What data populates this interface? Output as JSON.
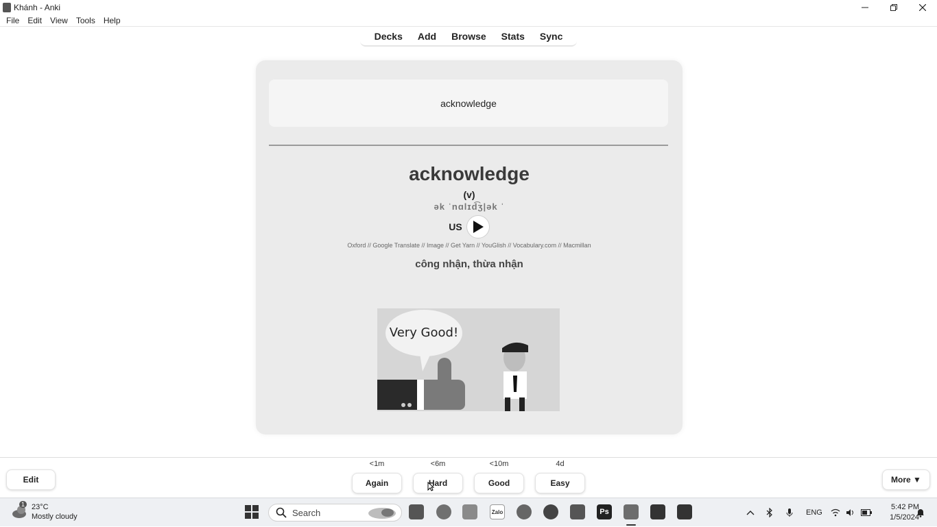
{
  "window": {
    "title": "Khánh - Anki"
  },
  "menu": {
    "items": [
      "File",
      "Edit",
      "View",
      "Tools",
      "Help"
    ]
  },
  "nav": {
    "items": [
      "Decks",
      "Add",
      "Browse",
      "Stats",
      "Sync"
    ]
  },
  "card": {
    "front": "acknowledge",
    "word": "acknowledge",
    "pos": "(v)",
    "ipa": "ək ˈnɑlɪd͡ʒ|ək ˈ",
    "audio_label": "US",
    "links": "Oxford // Google Translate // Image // Get Yarn // YouGlish // Vocabulary.com // Macmillan",
    "meaning": "công nhận, thừa nhận",
    "image_text": "Very Good!"
  },
  "answers": [
    {
      "due": "<1m",
      "label": "Again"
    },
    {
      "due": "<6m",
      "label": "Hard"
    },
    {
      "due": "<10m",
      "label": "Good"
    },
    {
      "due": "4d",
      "label": "Easy"
    }
  ],
  "bottom": {
    "edit_label": "Edit",
    "more_label": "More ▼"
  },
  "taskbar": {
    "weather_temp": "23°C",
    "weather_desc": "Mostly cloudy",
    "search_label": "Search",
    "zalo_label": "Zalo",
    "ps_label": "Ps",
    "lang": "ENG",
    "time": "5:42 PM",
    "date": "1/5/2024",
    "weather_badge": "1"
  },
  "colors": {
    "card_bg": "#ebebeb",
    "taskbar_bg": "#eef0f3",
    "accent": "#0067c0"
  }
}
